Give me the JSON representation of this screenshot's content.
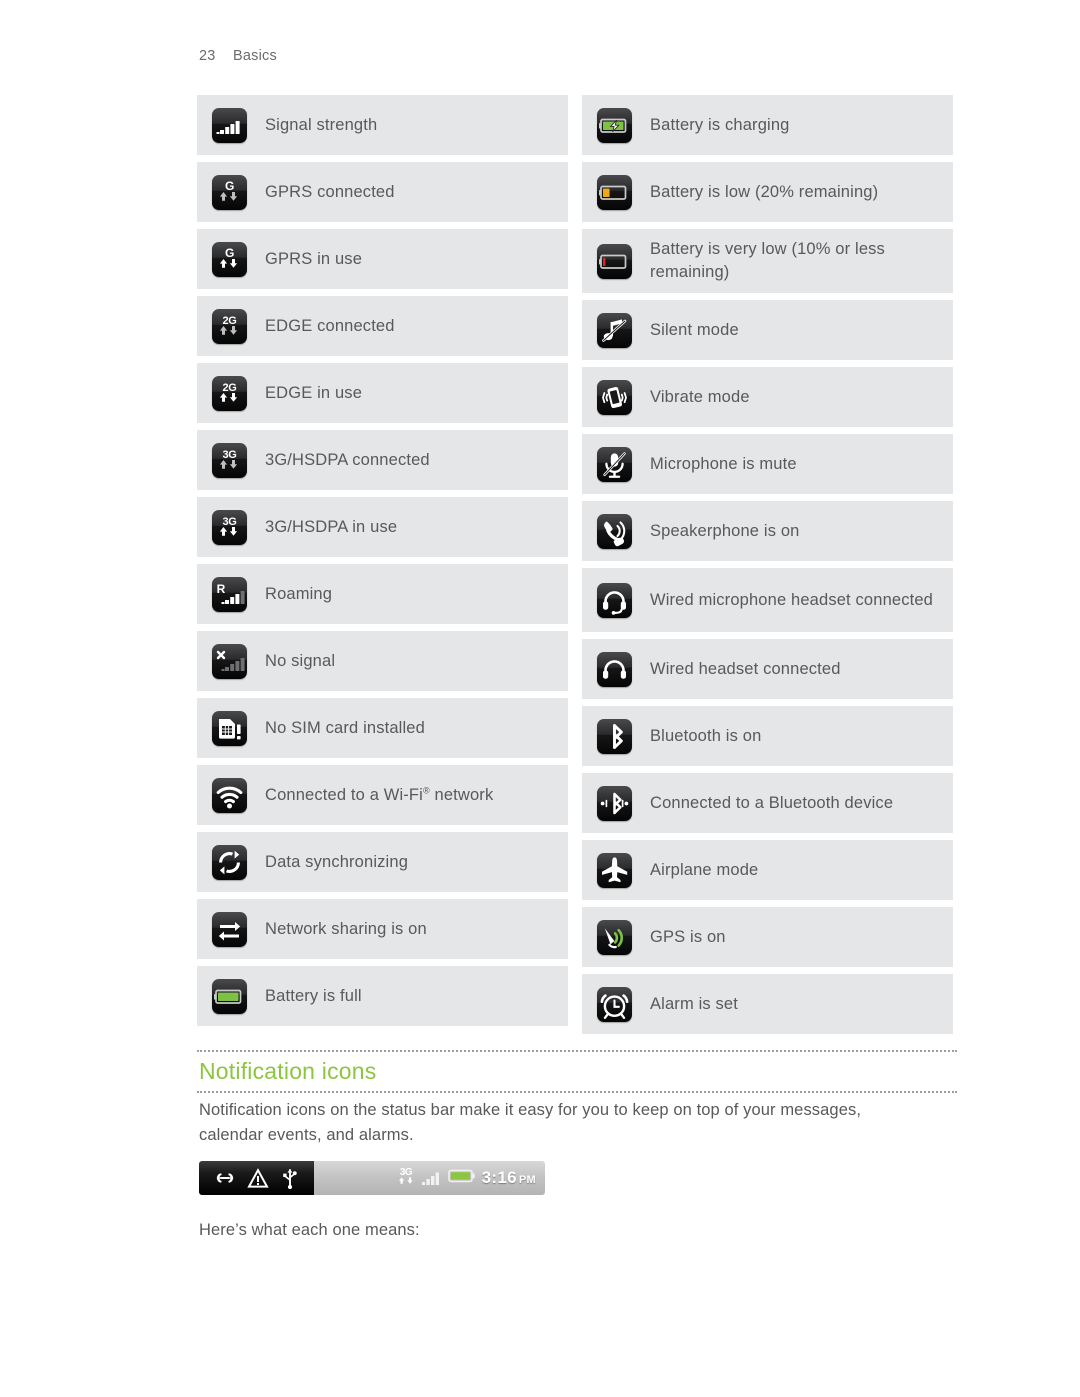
{
  "header": {
    "page_number": "23",
    "section": "Basics"
  },
  "icon_table": {
    "left_column": [
      {
        "icon": "signal-strength-icon",
        "label": "Signal strength",
        "lines": 1
      },
      {
        "icon": "gprs-connected-icon",
        "label": "GPRS connected",
        "lines": 1
      },
      {
        "icon": "gprs-in-use-icon",
        "label": "GPRS in use",
        "lines": 1
      },
      {
        "icon": "edge-connected-icon",
        "label": "EDGE connected",
        "lines": 1
      },
      {
        "icon": "edge-in-use-icon",
        "label": "EDGE in use",
        "lines": 1
      },
      {
        "icon": "hsdpa-connected-icon",
        "label": "3G/HSDPA connected",
        "lines": 1
      },
      {
        "icon": "hsdpa-in-use-icon",
        "label": "3G/HSDPA in use",
        "lines": 1
      },
      {
        "icon": "roaming-icon",
        "label": "Roaming",
        "lines": 1
      },
      {
        "icon": "no-signal-icon",
        "label": "No signal",
        "lines": 1
      },
      {
        "icon": "no-sim-card-icon",
        "label": "No SIM card installed",
        "lines": 1
      },
      {
        "icon": "wifi-connected-icon",
        "label": "Connected to a Wi-Fi",
        "label_sup": "®",
        "label_tail": " network",
        "lines": 1
      },
      {
        "icon": "data-sync-icon",
        "label": "Data synchronizing",
        "lines": 1
      },
      {
        "icon": "network-sharing-icon",
        "label": "Network sharing is on",
        "lines": 1
      },
      {
        "icon": "battery-full-icon",
        "label": "Battery is full",
        "lines": 1
      }
    ],
    "right_column": [
      {
        "icon": "battery-charging-icon",
        "label": "Battery is charging",
        "lines": 1
      },
      {
        "icon": "battery-low-icon",
        "label": "Battery is low (20% remaining)",
        "lines": 1
      },
      {
        "icon": "battery-very-low-icon",
        "label": "Battery is very low (10% or less remaining)",
        "lines": 2
      },
      {
        "icon": "silent-mode-icon",
        "label": "Silent mode",
        "lines": 1
      },
      {
        "icon": "vibrate-mode-icon",
        "label": "Vibrate mode",
        "lines": 1
      },
      {
        "icon": "microphone-mute-icon",
        "label": "Microphone is mute",
        "lines": 1
      },
      {
        "icon": "speakerphone-icon",
        "label": "Speakerphone is on",
        "lines": 1
      },
      {
        "icon": "wired-mic-headset-icon",
        "label": "Wired microphone headset connected",
        "lines": 2
      },
      {
        "icon": "wired-headset-icon",
        "label": "Wired headset connected",
        "lines": 1
      },
      {
        "icon": "bluetooth-on-icon",
        "label": "Bluetooth is on",
        "lines": 1
      },
      {
        "icon": "bluetooth-connected-icon",
        "label": "Connected to a Bluetooth device",
        "lines": 1
      },
      {
        "icon": "airplane-mode-icon",
        "label": "Airplane mode",
        "lines": 1
      },
      {
        "icon": "gps-on-icon",
        "label": "GPS is on",
        "lines": 1
      },
      {
        "icon": "alarm-set-icon",
        "label": "Alarm is set",
        "lines": 1
      }
    ]
  },
  "section": {
    "title": "Notification icons",
    "intro": "Notification icons on the status bar make it easy for you to keep on top of your messages, calendar events, and alarms.",
    "outro": "Here’s what each one means:"
  },
  "status_bar_figure": {
    "notification_icons": [
      "link-icon",
      "warning-triangle-icon",
      "usb-icon"
    ],
    "status_icons": [
      "hsdpa-in-use-icon",
      "signal-strength-icon",
      "battery-full-icon"
    ],
    "time": "3:16",
    "ampm": "PM"
  },
  "colors": {
    "accent_green": "#8cc63f",
    "row_background": "#e5e6e7",
    "text": "#58595b",
    "battery_full_green": "#7dc242",
    "battery_low_orange": "#f3a712",
    "battery_very_low_red": "#e02020"
  }
}
